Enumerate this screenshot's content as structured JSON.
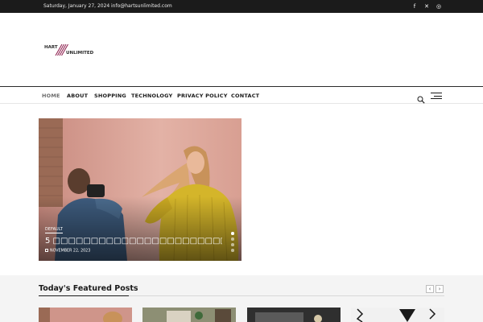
{
  "topbar": {
    "date": "Saturday, January 27, 2024",
    "email": "info@hartsunlimited.com",
    "social": [
      {
        "name": "facebook-icon",
        "glyph": "f"
      },
      {
        "name": "x-icon",
        "glyph": "✕"
      },
      {
        "name": "instagram-icon",
        "glyph": "◎"
      }
    ]
  },
  "header": {
    "logo_top": "HART",
    "logo_bottom": "UNLIMITED",
    "logo_accent": "#8b1a4a"
  },
  "nav": {
    "items": [
      {
        "label": "HOME",
        "active": true
      },
      {
        "label": "ABOUT"
      },
      {
        "label": "SHOPPING"
      },
      {
        "label": "TECHNOLOGY"
      },
      {
        "label": "PRIVACY POLICY"
      },
      {
        "label": "CONTACT"
      }
    ],
    "icons": [
      "search-icon",
      "hamburger-menu-icon"
    ]
  },
  "hero": {
    "badge": "DEFAULT",
    "title": "5 □□□□□□□□□□□□□□□□□□□□□□□",
    "date": "NOVEMBER 22, 2023",
    "slides": 4,
    "active_slide": 1
  },
  "featured": {
    "title": "Today's Featured Posts",
    "prev": "‹",
    "next": "›"
  },
  "colors": {
    "topbar_bg": "#1b1b1b",
    "accent": "#8b1a4a",
    "section_bg": "#f4f4f4"
  }
}
